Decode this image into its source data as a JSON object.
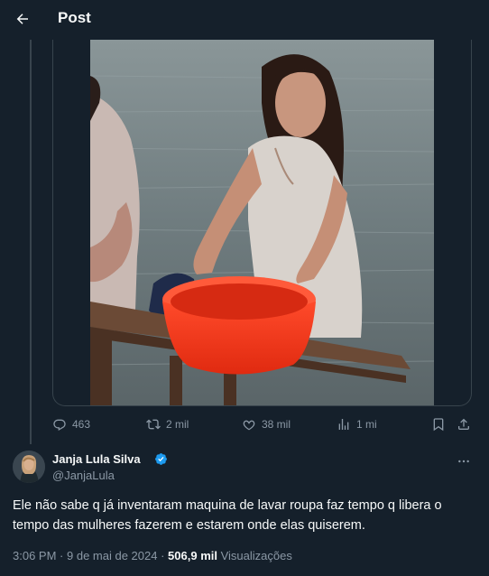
{
  "header": {
    "title": "Post",
    "back_icon": "arrow-left-icon"
  },
  "media": {
    "type": "video-still",
    "alt_visible": ""
  },
  "actions": {
    "replies": "463",
    "reposts": "2 mil",
    "likes": "38 mil",
    "views": "1 mi"
  },
  "author": {
    "name": "Janja Lula Silva",
    "handle": "@JanjaLula",
    "verified": true,
    "verified_color": "#1d9bf0"
  },
  "post": {
    "text": "Ele não sabe q já inventaram maquina de lavar roupa faz tempo q libera o tempo das mulheres fazerem e estarem onde elas quiserem."
  },
  "meta": {
    "time": "3:06 PM",
    "date": "9 de mai de 2024",
    "views_count": "506,9 mil",
    "views_label": "Visualizações"
  },
  "colors": {
    "background": "#15202b",
    "border": "#38444d",
    "muted": "#8b98a5",
    "text": "#f7f9f9"
  }
}
